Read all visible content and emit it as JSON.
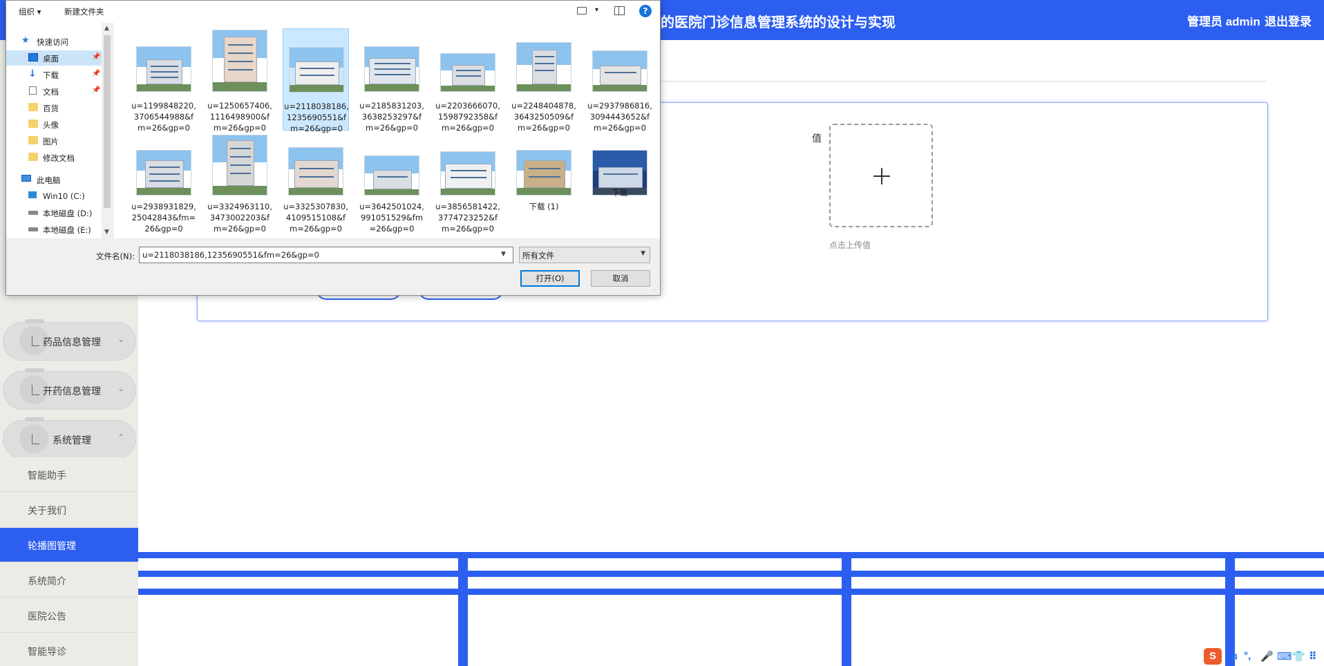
{
  "app": {
    "title": "的医院门诊信息管理系统的设计与实现",
    "admin_label": "管理员 admin",
    "logout_label": "退出登录"
  },
  "sidebar": {
    "menu_groups": [
      {
        "label": "药品信息管理",
        "arrow": "⌄"
      },
      {
        "label": "开药信息管理",
        "arrow": "⌄"
      },
      {
        "label": "系统管理",
        "arrow": "⌃"
      }
    ],
    "sub_items": [
      {
        "label": "智能助手",
        "active": false
      },
      {
        "label": "关于我们",
        "active": false
      },
      {
        "label": "轮播图管理",
        "active": true
      },
      {
        "label": "系统简介",
        "active": false
      },
      {
        "label": "医院公告",
        "active": false
      },
      {
        "label": "智能导诊",
        "active": false
      }
    ]
  },
  "form": {
    "value_label": "值",
    "upload_hint": "点击上传值"
  },
  "dialog": {
    "toolbar": {
      "organize": "组织 ▾",
      "new_folder": "新建文件夹",
      "help": "?"
    },
    "nav": [
      {
        "label": "快速访问",
        "icon": "star-icon",
        "pinned": false,
        "selected": false
      },
      {
        "label": "桌面",
        "icon": "desktop-icon",
        "pinned": true,
        "selected": true
      },
      {
        "label": "下载",
        "icon": "download-icon",
        "pinned": true,
        "selected": false
      },
      {
        "label": "文档",
        "icon": "document-icon",
        "pinned": true,
        "selected": false
      },
      {
        "label": "百货",
        "icon": "folder-icon",
        "pinned": false,
        "selected": false
      },
      {
        "label": "头像",
        "icon": "folder-icon",
        "pinned": false,
        "selected": false
      },
      {
        "label": "图片",
        "icon": "folder-icon",
        "pinned": false,
        "selected": false
      },
      {
        "label": "修改文档",
        "icon": "folder-icon",
        "pinned": false,
        "selected": false
      },
      {
        "label": "此电脑",
        "icon": "computer-icon",
        "pinned": false,
        "selected": false
      },
      {
        "label": "Win10 (C:)",
        "icon": "windows-drive-icon",
        "pinned": false,
        "selected": false
      },
      {
        "label": "本地磁盘 (D:)",
        "icon": "drive-icon",
        "pinned": false,
        "selected": false
      },
      {
        "label": "本地磁盘 (E:)",
        "icon": "drive-icon",
        "pinned": false,
        "selected": false
      }
    ],
    "files": [
      {
        "name": "u=1199848220,3706544988&fm=26&gp=0",
        "selected": false
      },
      {
        "name": "u=1250657406,1116498900&fm=26&gp=0",
        "selected": false
      },
      {
        "name": "u=2118038186,1235690551&fm=26&gp=0",
        "selected": true
      },
      {
        "name": "u=2185831203,3638253297&fm=26&gp=0",
        "selected": false
      },
      {
        "name": "u=2203666070,1598792358&fm=26&gp=0",
        "selected": false
      },
      {
        "name": "u=2248404878,3643250509&fm=26&gp=0",
        "selected": false
      },
      {
        "name": "u=2937986816,3094443652&fm=26&gp=0",
        "selected": false
      },
      {
        "name": "u=2938931829,25042843&fm=26&gp=0",
        "selected": false
      },
      {
        "name": "u=3324963110,3473002203&fm=26&gp=0",
        "selected": false
      },
      {
        "name": "u=3325307830,4109515108&fm=26&gp=0",
        "selected": false
      },
      {
        "name": "u=3642501024,991051529&fm=26&gp=0",
        "selected": false
      },
      {
        "name": "u=3856581422,3774723252&fm=26&gp=0",
        "selected": false
      },
      {
        "name": "下载 (1)",
        "selected": false
      },
      {
        "name": "下载",
        "selected": false
      }
    ],
    "filename_label": "文件名(N):",
    "filename_value": "u=2118038186,1235690551&fm=26&gp=0",
    "filetype_value": "所有文件",
    "open_label": "打开(O)",
    "cancel_label": "取消"
  },
  "ime": {
    "logo": "S",
    "items": [
      "中",
      "°,",
      "🎤",
      "⌨",
      "👕",
      "⠿"
    ]
  },
  "colors": {
    "accent": "#2c5ef0",
    "sidebar_bg": "#ecece7",
    "dialog_sel": "#cce4f7"
  }
}
